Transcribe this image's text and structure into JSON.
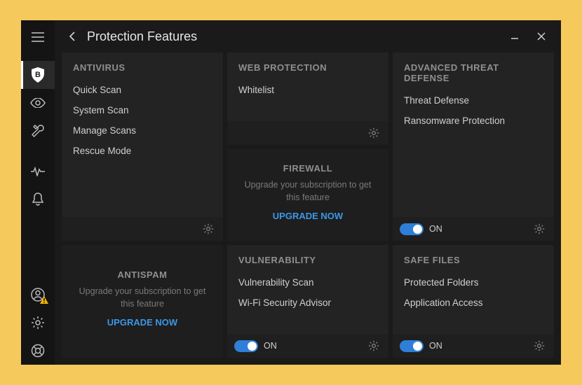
{
  "header": {
    "title": "Protection Features"
  },
  "sidebar": {
    "items": [
      {
        "name": "menu-icon"
      },
      {
        "name": "shield-b-icon"
      },
      {
        "name": "eye-icon"
      },
      {
        "name": "tools-icon"
      },
      {
        "name": "activity-icon"
      },
      {
        "name": "bell-icon"
      },
      {
        "name": "account-icon"
      },
      {
        "name": "settings-icon"
      },
      {
        "name": "support-icon"
      }
    ]
  },
  "upgrade": {
    "message": "Upgrade your subscription to get this feature",
    "cta": "UPGRADE NOW"
  },
  "toggle": {
    "on_label": "ON"
  },
  "cards": {
    "antivirus": {
      "title": "ANTIVIRUS",
      "items": [
        "Quick Scan",
        "System Scan",
        "Manage Scans",
        "Rescue Mode"
      ]
    },
    "antispam": {
      "title": "ANTISPAM"
    },
    "web_protection": {
      "title": "WEB PROTECTION",
      "items": [
        "Whitelist"
      ]
    },
    "firewall": {
      "title": "FIREWALL"
    },
    "vulnerability": {
      "title": "VULNERABILITY",
      "items": [
        "Vulnerability Scan",
        "Wi-Fi Security Advisor"
      ]
    },
    "atd": {
      "title": "ADVANCED THREAT DEFENSE",
      "items": [
        "Threat Defense",
        "Ransomware Protection"
      ]
    },
    "safe_files": {
      "title": "SAFE FILES",
      "items": [
        "Protected Folders",
        "Application Access"
      ]
    }
  }
}
